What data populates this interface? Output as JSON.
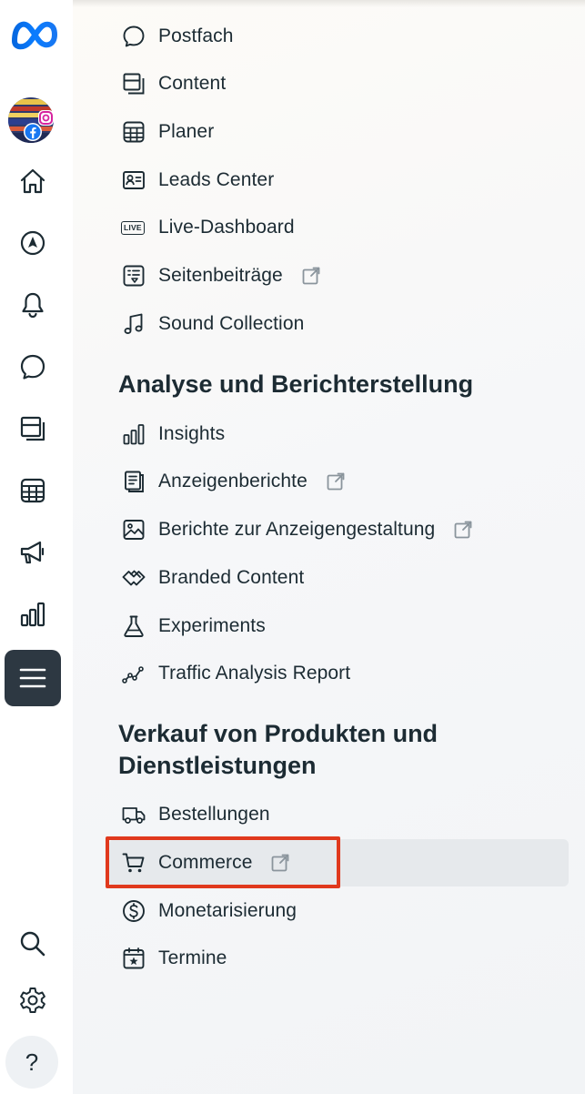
{
  "colors": {
    "accent_highlight": "#e0391d",
    "rail_active": "#2d3842",
    "text": "#1c2b33",
    "icon": "#1c2b33"
  },
  "rail": {
    "logo": "meta-logo",
    "items": [
      {
        "name": "account-avatar",
        "icon": "avatar"
      },
      {
        "name": "home",
        "icon": "home-icon"
      },
      {
        "name": "navigate",
        "icon": "compass-icon"
      },
      {
        "name": "notifications",
        "icon": "bell-icon"
      },
      {
        "name": "inbox",
        "icon": "chat-bubble-icon"
      },
      {
        "name": "content",
        "icon": "content-stack-icon"
      },
      {
        "name": "planner",
        "icon": "calendar-grid-icon"
      },
      {
        "name": "ads",
        "icon": "megaphone-icon"
      },
      {
        "name": "insights",
        "icon": "bar-chart-icon"
      },
      {
        "name": "all-tools",
        "icon": "hamburger-menu-icon",
        "active": true
      },
      {
        "name": "search",
        "icon": "search-icon"
      },
      {
        "name": "settings",
        "icon": "gear-icon"
      },
      {
        "name": "help",
        "icon": "help-icon"
      }
    ],
    "help_glyph": "?"
  },
  "menu": {
    "items_top": [
      {
        "label": "Postfach",
        "icon": "chat-bubble-icon"
      },
      {
        "label": "Content",
        "icon": "content-stack-icon"
      },
      {
        "label": "Planer",
        "icon": "calendar-grid-icon"
      },
      {
        "label": "Leads Center",
        "icon": "contact-card-icon"
      },
      {
        "label": "Live-Dashboard",
        "icon": "live-badge-icon",
        "badge": "LIVE"
      },
      {
        "label": "Seitenbeiträge",
        "icon": "page-posts-icon",
        "external": true
      },
      {
        "label": "Sound Collection",
        "icon": "music-note-icon"
      }
    ],
    "section_analysis": {
      "title": "Analyse und Berichterstellung",
      "items": [
        {
          "label": "Insights",
          "icon": "bar-chart-icon"
        },
        {
          "label": "Anzeigenberichte",
          "icon": "report-doc-icon",
          "external": true
        },
        {
          "label": "Berichte zur Anzeigengestaltung",
          "icon": "image-icon",
          "external": true
        },
        {
          "label": "Branded Content",
          "icon": "handshake-icon"
        },
        {
          "label": "Experiments",
          "icon": "flask-icon"
        },
        {
          "label": "Traffic Analysis Report",
          "icon": "trend-line-icon"
        }
      ]
    },
    "section_sales": {
      "title": "Verkauf von Produkten und Dienstleistungen",
      "items": [
        {
          "label": "Bestellungen",
          "icon": "truck-icon"
        },
        {
          "label": "Commerce",
          "icon": "cart-icon",
          "external": true,
          "highlighted": true
        },
        {
          "label": "Monetarisierung",
          "icon": "dollar-circle-icon"
        },
        {
          "label": "Termine",
          "icon": "calendar-star-icon"
        }
      ]
    }
  }
}
